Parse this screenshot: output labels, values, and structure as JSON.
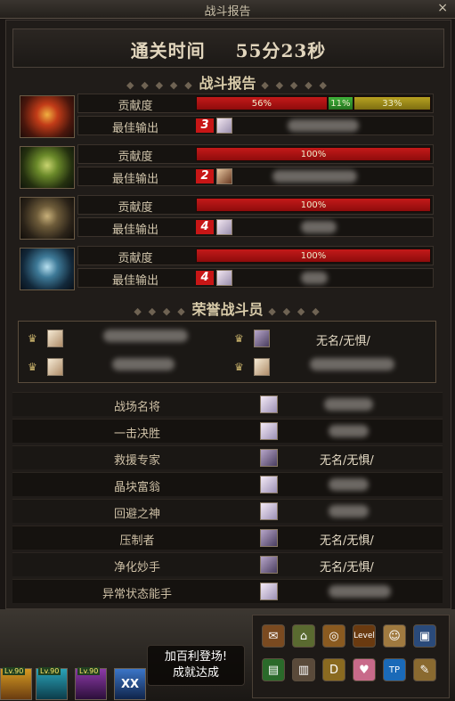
{
  "window": {
    "title": "战斗报告",
    "close_label": "×"
  },
  "clear_time": {
    "label": "通关时间",
    "value": "55分23秒"
  },
  "report_section": {
    "title": "战斗报告"
  },
  "contribution_label": "贡献度",
  "best_output_label": "最佳输出",
  "players": [
    {
      "class": "red-helm",
      "segments": [
        {
          "pct": 56,
          "color": "red",
          "label": "56%"
        },
        {
          "pct": 11,
          "color": "green",
          "label": "11%"
        },
        {
          "pct": 33,
          "color": "yellow",
          "label": "33%"
        }
      ],
      "rank": "3"
    },
    {
      "class": "green-helm",
      "segments": [
        {
          "pct": 100,
          "color": "red",
          "label": "100%"
        }
      ],
      "rank": "2"
    },
    {
      "class": "gold-helm",
      "segments": [
        {
          "pct": 100,
          "color": "red",
          "label": "100%"
        }
      ],
      "rank": "4"
    },
    {
      "class": "blue-helm",
      "segments": [
        {
          "pct": 100,
          "color": "red",
          "label": "100%"
        }
      ],
      "rank": "4"
    }
  ],
  "honor_section": {
    "title": "荣誉战斗员"
  },
  "honor_members": [
    {
      "name": ""
    },
    {
      "name": "无名/无惧/"
    },
    {
      "name": ""
    },
    {
      "name": ""
    }
  ],
  "awards": [
    {
      "title": "战场名将",
      "player": ""
    },
    {
      "title": "一击决胜",
      "player": ""
    },
    {
      "title": "救援专家",
      "player": "无名/无惧/"
    },
    {
      "title": "晶块富翁",
      "player": ""
    },
    {
      "title": "回避之神",
      "player": ""
    },
    {
      "title": "压制者",
      "player": "无名/无惧/"
    },
    {
      "title": "净化妙手",
      "player": "无名/无惧/"
    },
    {
      "title": "异常状态能手",
      "player": ""
    }
  ],
  "notice": {
    "line1": "加百利登场!",
    "line2": "成就达成"
  },
  "hotbar_level_label": "Level",
  "party": [
    {
      "lv": "Lv.90"
    },
    {
      "lv": "Lv.90"
    },
    {
      "lv": "Lv.90"
    },
    {
      "lv": "XX"
    }
  ],
  "colors": {
    "red": "#c41a1a",
    "green": "#3fb23a",
    "yellow": "#b7a221"
  }
}
